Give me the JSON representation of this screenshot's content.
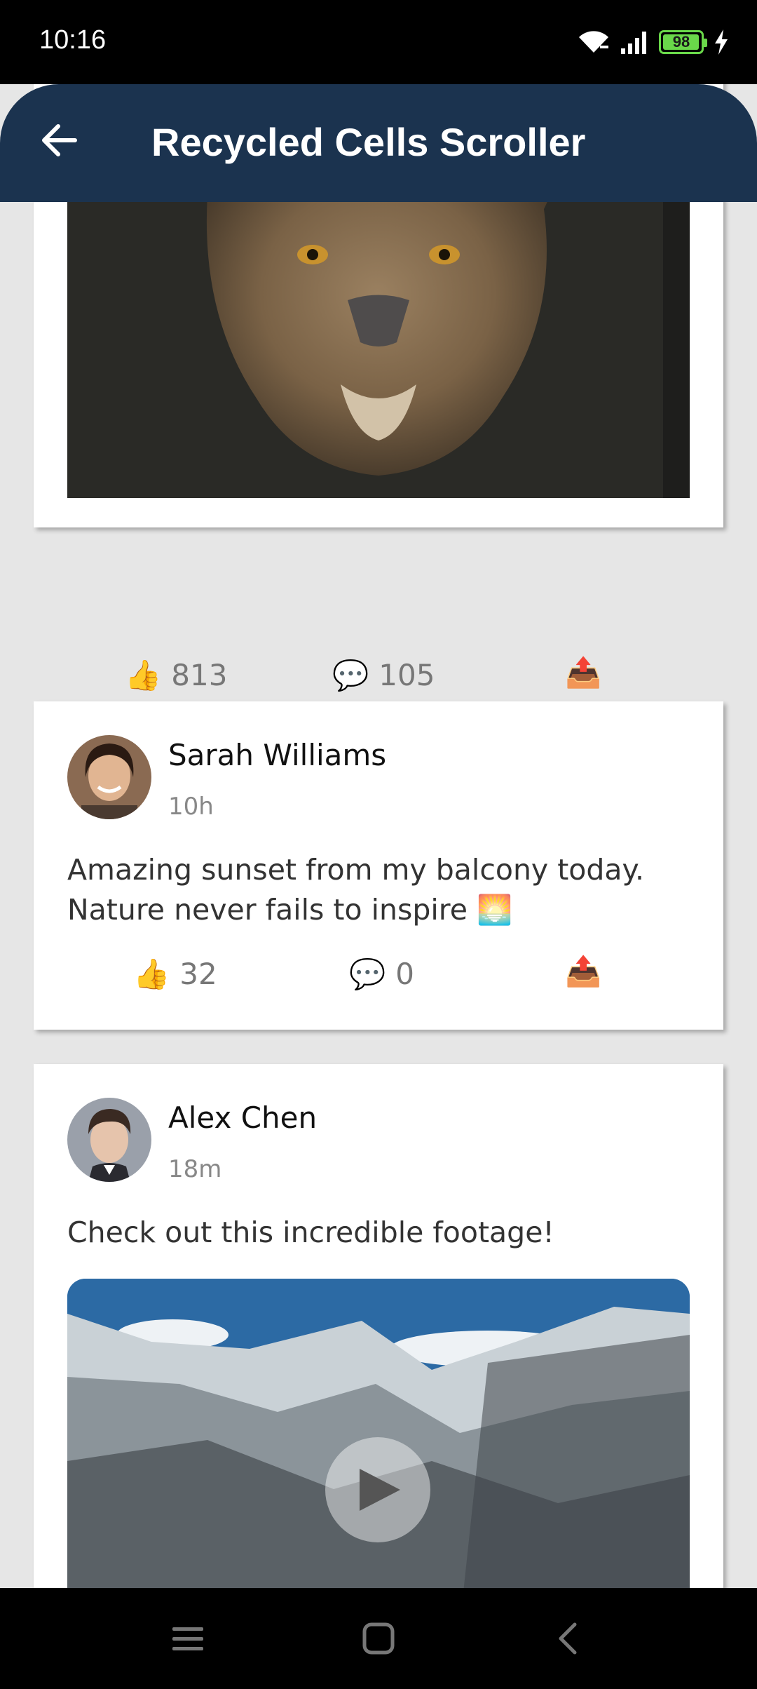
{
  "status_bar": {
    "time": "10:16",
    "battery_level": "98",
    "battery_percent": 98
  },
  "app_bar": {
    "title": "Recycled Cells Scroller",
    "background": "#1b334f",
    "back_icon": "arrow-left-icon"
  },
  "feed": {
    "background": "#e6e6e6",
    "posts": [
      {
        "kind": "image",
        "likes": "813",
        "comments": "105"
      },
      {
        "kind": "text",
        "author": "Sarah Williams",
        "time": "10h",
        "text": "Amazing sunset from my balcony today. Nature never fails to inspire 🌅",
        "likes": "32",
        "comments": "0"
      },
      {
        "kind": "video",
        "author": "Alex Chen",
        "time": "18m",
        "text": "Check out this incredible footage!"
      }
    ]
  },
  "icons": {
    "like": "👍",
    "comment": "💬",
    "share": "📤"
  },
  "nav_bar": {
    "icons": [
      "menu-icon",
      "home-icon",
      "back-icon"
    ]
  },
  "colors": {
    "accent_like": "#f3b12e",
    "comment_blue": "#4a9be8",
    "share_orange": "#f29d2b"
  }
}
